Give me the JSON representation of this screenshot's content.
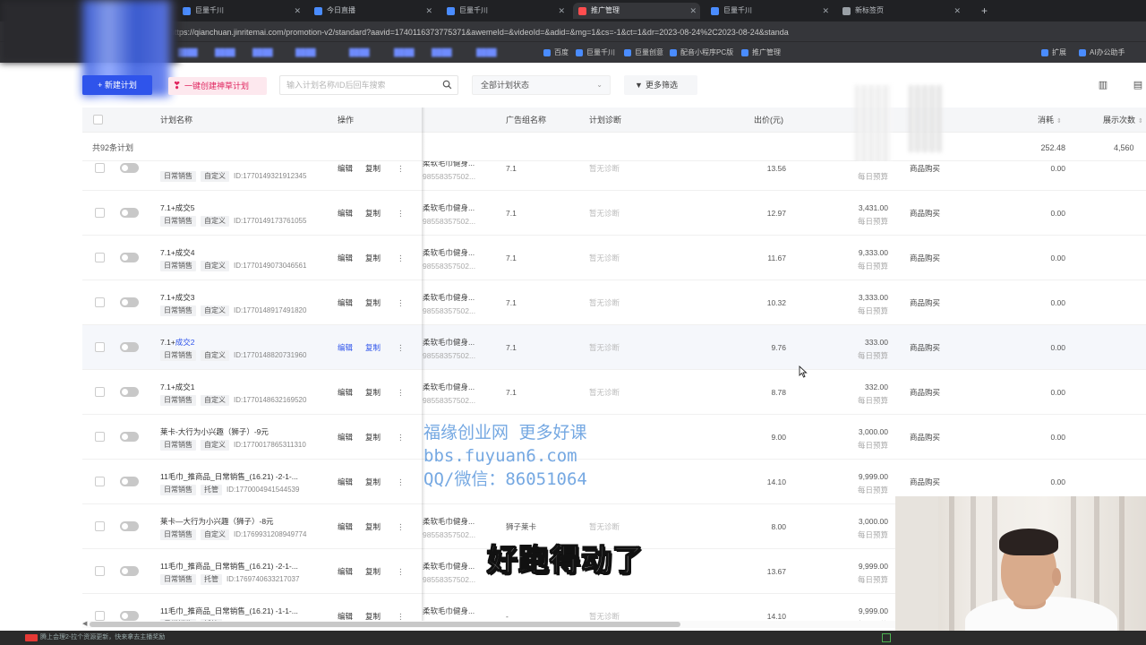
{
  "browser": {
    "tabs": [
      {
        "label": "巨量千川",
        "active": false
      },
      {
        "label": "今日直播",
        "active": false
      },
      {
        "label": "巨量千川",
        "active": false
      },
      {
        "label": "推广管理",
        "active": true
      },
      {
        "label": "巨量千川",
        "active": false
      },
      {
        "label": "新标签页",
        "active": false
      }
    ],
    "url": "https://qianchuan.jinritemai.com/promotion-v2/standard?aavid=1740116373775371&awemeId=&videoId=&adid=&mg=1&cs=-1&ct=1&dr=2023-08-24%2C2023-08-24&standa",
    "bookmarks": [
      "百度",
      "巨量千川",
      "巨量创意",
      "配音小程序PC版",
      "推广管理"
    ],
    "bookmarks_right": [
      "扩展",
      "AI办公助手"
    ]
  },
  "toolbar": {
    "new_plan": "+ 新建计划",
    "one_click": "一键创建神草计划",
    "search_placeholder": "输入计划名称/ID后回车搜索",
    "status_select": "全部计划状态",
    "more_filter": "更多筛选"
  },
  "table": {
    "headers": {
      "name": "计划名称",
      "op": "操作",
      "ad_group": "广告组名称",
      "diagnosis": "计划诊断",
      "bid": "出价(元)",
      "cost": "消耗",
      "impressions": "展示次数"
    },
    "summary": {
      "count": "共92条计划",
      "cost_total": "252.48",
      "impressions_total": "4,560"
    },
    "edit_label": "编辑",
    "copy_label": "复制",
    "more_label": "⋮",
    "budget_label": "每日预算",
    "rows": [
      {
        "name": "",
        "tag1": "日常销售",
        "tag2": "自定义",
        "id": "ID:1770149321912345",
        "ad": "柔软毛巾健身...",
        "ad_id": "98558357502...",
        "group": "7.1",
        "diag": "暂无诊断",
        "bid": "13.56",
        "budget": "",
        "goal": "商品购买",
        "cost": "0.00"
      },
      {
        "name": "7.1+成交5",
        "tag1": "日常销售",
        "tag2": "自定义",
        "id": "ID:1770149173761055",
        "ad": "柔软毛巾健身...",
        "ad_id": "98558357502...",
        "group": "7.1",
        "diag": "暂无诊断",
        "bid": "12.97",
        "budget": "3,431.00",
        "goal": "商品购买",
        "cost": "0.00"
      },
      {
        "name": "7.1+成交4",
        "tag1": "日常销售",
        "tag2": "自定义",
        "id": "ID:1770149073046561",
        "ad": "柔软毛巾健身...",
        "ad_id": "98558357502...",
        "group": "7.1",
        "diag": "暂无诊断",
        "bid": "11.67",
        "budget": "9,333.00",
        "goal": "商品购买",
        "cost": "0.00"
      },
      {
        "name": "7.1+成交3",
        "tag1": "日常销售",
        "tag2": "自定义",
        "id": "ID:1770148917491820",
        "ad": "柔软毛巾健身...",
        "ad_id": "98558357502...",
        "group": "7.1",
        "diag": "暂无诊断",
        "bid": "10.32",
        "budget": "3,333.00",
        "goal": "商品购买",
        "cost": "0.00"
      },
      {
        "name": "7.1+",
        "name_link": "成交2",
        "tag1": "日常销售",
        "tag2": "自定义",
        "id": "ID:1770148820731960",
        "ad": "柔软毛巾健身...",
        "ad_id": "98558357502...",
        "group": "7.1",
        "diag": "暂无诊断",
        "bid": "9.76",
        "budget": "333.00",
        "goal": "商品购买",
        "cost": "0.00",
        "hl": true
      },
      {
        "name": "7.1+成交1",
        "tag1": "日常销售",
        "tag2": "自定义",
        "id": "ID:1770148632169520",
        "ad": "柔软毛巾健身...",
        "ad_id": "98558357502...",
        "group": "7.1",
        "diag": "暂无诊断",
        "bid": "8.78",
        "budget": "332.00",
        "goal": "商品购买",
        "cost": "0.00"
      },
      {
        "name": "莱卡-大行为小兴趣（狮子）-9元",
        "tag1": "日常销售",
        "tag2": "自定义",
        "id": "ID:1770017865311310",
        "ad": "",
        "ad_id": "",
        "group": "",
        "diag": "",
        "bid": "9.00",
        "budget": "3,000.00",
        "goal": "商品购买",
        "cost": "0.00"
      },
      {
        "name": "11毛巾_推商品_日常销售_(16.21) -2-1-...",
        "tag1": "日常销售",
        "tag2": "托管",
        "id": "ID:1770004941544539",
        "ad": "",
        "ad_id": "",
        "group": "",
        "diag": "",
        "bid": "14.10",
        "budget": "9,999.00",
        "goal": "商品购买",
        "cost": "0.00"
      },
      {
        "name": "莱卡—大行为小兴趣（狮子）-8元",
        "tag1": "日常销售",
        "tag2": "自定义",
        "id": "ID:1769931208949774",
        "ad": "柔软毛巾健身...",
        "ad_id": "98558357502...",
        "group": "狮子莱卡",
        "diag": "暂无诊断",
        "bid": "8.00",
        "budget": "3,000.00",
        "goal": "商品购买",
        "cost": "0.00"
      },
      {
        "name": "11毛巾_推商品_日常销售_(16.21) -2-1-...",
        "tag1": "日常销售",
        "tag2": "托管",
        "id": "ID:1769740633217037",
        "ad": "柔软毛巾健身...",
        "ad_id": "98558357502...",
        "group": "",
        "diag": "",
        "bid": "13.67",
        "budget": "9,999.00",
        "goal": "商品购买",
        "cost": "0.00"
      },
      {
        "name": "11毛巾_推商品_日常销售_(16.21) -1-1-...",
        "tag1": "日常销售",
        "tag2": "托管",
        "id": "ID:1769740539779075",
        "ad": "柔软毛巾健身...",
        "ad_id": "98558357502...",
        "group": "-",
        "diag": "暂无诊断",
        "bid": "14.10",
        "budget": "9,999.00",
        "goal": "商品购买",
        "cost": "0.00"
      }
    ]
  },
  "overlay": {
    "watermark_lines": [
      "福缘创业网 更多好课",
      "bbs.fuyuan6.com",
      "QQ/微信：86051064"
    ],
    "subtitle": "好跑得动了"
  },
  "taskbar": {
    "notice": "腾上会理2-拉个资源更新，快来拿去主播奖励"
  },
  "colors": {
    "primary": "#2f54eb",
    "pink": "#e0245e",
    "watermark": "#4086d7"
  }
}
